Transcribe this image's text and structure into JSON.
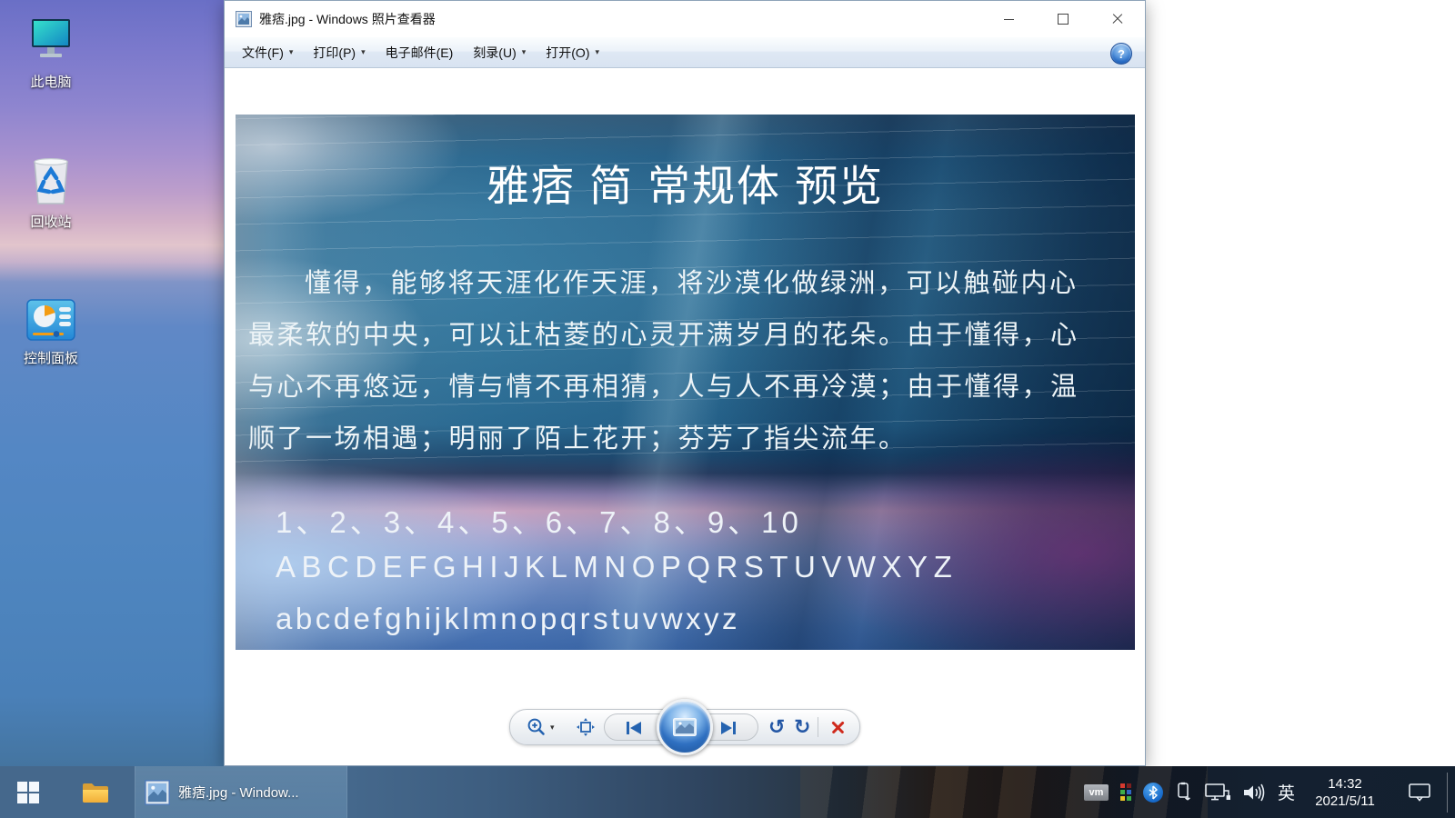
{
  "desktop": {
    "icons": [
      {
        "label": "此电脑"
      },
      {
        "label": "回收站"
      },
      {
        "label": "控制面板"
      }
    ]
  },
  "window": {
    "title": "雅痞.jpg - Windows 照片查看器",
    "menu": {
      "items": [
        {
          "label": "文件(F)"
        },
        {
          "label": "打印(P)"
        },
        {
          "label": "电子邮件(E)"
        },
        {
          "label": "刻录(U)"
        },
        {
          "label": "打开(O)"
        }
      ]
    }
  },
  "photo": {
    "title": "雅痞 简 常规体 预览",
    "paragraph_lines": [
      "懂得，能够将天涯化作天涯，将沙漠化做绿洲，可以触碰内心",
      "最柔软的中央，可以让枯菱的心灵开满岁月的花朵。由于懂得，心",
      "与心不再悠远，情与情不再相猜，人与人不再冷漠；由于懂得，温",
      "顺了一场相遇；明丽了陌上花开；芬芳了指尖流年。"
    ],
    "numbers": "1、2、3、4、5、6、7、8、9、10",
    "uppercase": "ABCDEFGHIJKLMNOPQRSTUVWXYZ",
    "lowercase": "abcdefghijklmnopqrstuvwxyz"
  },
  "icons": {
    "dropdown": "▾",
    "help": "?",
    "rotate_ccw": "↺",
    "rotate_cw": "↻"
  },
  "taskbar": {
    "task_label": "雅痞.jpg - Window...",
    "tray": {
      "vm": "vm",
      "ime": "英",
      "time": "14:32",
      "date": "2021/5/11"
    }
  },
  "colors": {
    "accent_blue": "#2563b0",
    "delete_red": "#cf2a1d",
    "taskbar_left": "#45688c",
    "wall_pink": "#f0a79c",
    "wall_blue": "#5487c4"
  }
}
